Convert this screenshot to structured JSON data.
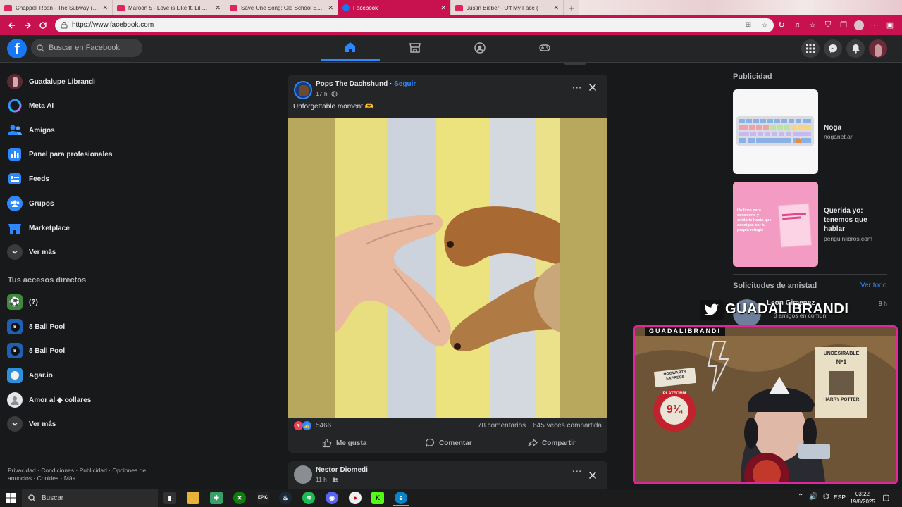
{
  "browser": {
    "tabs": [
      {
        "label": "Chappell Roan - The Subway (Offi",
        "active": false,
        "close": "✕"
      },
      {
        "label": "Maroon 5 - Love is Like ft. Lil Way",
        "active": false,
        "close": "✕"
      },
      {
        "label": "Save One Song: Old School Editio",
        "active": false,
        "close": "✕"
      },
      {
        "label": "Facebook",
        "active": true,
        "close": "✕"
      },
      {
        "label": "Justin Bieber - Off My Face (",
        "active": false,
        "close": "✕"
      }
    ],
    "new_tab": "+",
    "url": "https://www.facebook.com"
  },
  "fb": {
    "search_placeholder": "Buscar en Facebook",
    "logo_letter": "f"
  },
  "sidebar": {
    "items": [
      {
        "label": "Guadalupe Librandi",
        "icon": "profile-avatar"
      },
      {
        "label": "Meta AI",
        "icon": "meta-ai-icon"
      },
      {
        "label": "Amigos",
        "icon": "friends-icon"
      },
      {
        "label": "Panel para profesionales",
        "icon": "dashboard-icon"
      },
      {
        "label": "Feeds",
        "icon": "feeds-icon"
      },
      {
        "label": "Grupos",
        "icon": "groups-icon"
      },
      {
        "label": "Marketplace",
        "icon": "marketplace-icon"
      },
      {
        "label": "Ver más",
        "icon": "chevron-down-icon"
      }
    ],
    "shortcuts_title": "Tus accesos directos",
    "shortcuts": [
      {
        "label": "(?)",
        "icon": "soccer-icon"
      },
      {
        "label": "8 Ball Pool",
        "icon": "8ball-icon"
      },
      {
        "label": "8 Ball Pool",
        "icon": "8ball-icon"
      },
      {
        "label": "Agar.io",
        "icon": "agar-icon"
      },
      {
        "label": "Amor al ◆ collares",
        "icon": "user-icon"
      },
      {
        "label": "Ver más",
        "icon": "chevron-down-icon"
      }
    ],
    "footer_line1": "Privacidad · Condiciones · Publicidad · Opciones de",
    "footer_line2": "anuncios · Cookies · Más"
  },
  "post": {
    "author": "Pops The Dachshund",
    "follow": "Seguir",
    "separator": "·",
    "time": "17 h · ",
    "text": "Unforgettable moment 🫶",
    "reaction_count": "5466",
    "comments": "78 comentarios",
    "shares": "645 veces compartida",
    "like": "Me gusta",
    "comment": "Comentar",
    "share": "Compartir"
  },
  "post2": {
    "author": "Nestor Diomedi",
    "time": "11 h · "
  },
  "right": {
    "ads_title": "Publicidad",
    "ads": [
      {
        "title": "Noga",
        "url": "noganet.ar"
      },
      {
        "title": "Querida yo: tenemos que hablar",
        "url": "penguinlibros.com"
      }
    ],
    "ad2_book_text": "Un libro para conocerte y cuidarte hasta que consigas ser tu propio refugio",
    "friend_requests": "Solicitudes de amistad",
    "see_all": "Ver todo",
    "request_name": "Leon Gimenez",
    "request_mutual": "3 amigos en común",
    "request_time": "9 h"
  },
  "stream": {
    "twitter_handle": "GUADALIBRANDI",
    "cam_label": "GUADALIBRANDI",
    "poster_undesirable": "UNDESIRABLE",
    "poster_no": "Nº1",
    "poster_name": "HARRY POTTER",
    "platform_label": "PLATFORM",
    "platform_number": "9¾",
    "hogwarts_label": "HOGWARTS EXPRESS"
  },
  "taskbar": {
    "search_placeholder": "Buscar",
    "lang": "ESP",
    "time": "03:22",
    "date": "19/8/2025"
  }
}
